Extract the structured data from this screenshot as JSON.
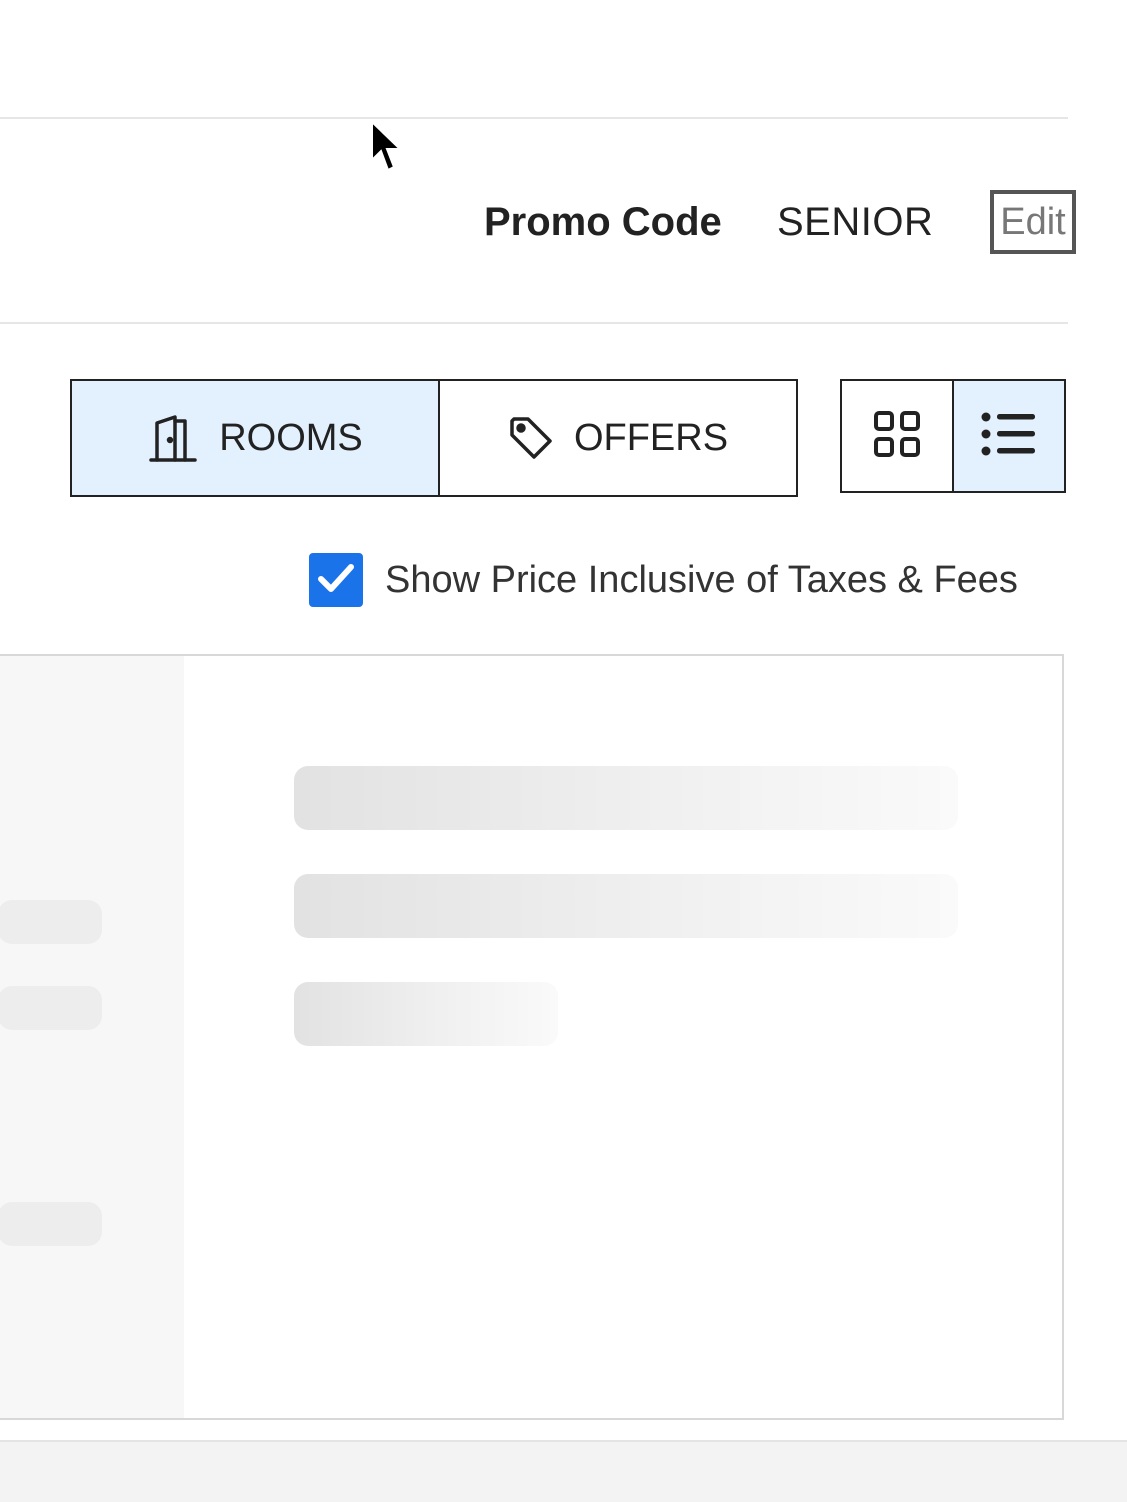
{
  "promo": {
    "label": "Promo Code",
    "value": "SENIOR",
    "edit_label": "Edit"
  },
  "tabs": {
    "rooms": {
      "label": "ROOMS",
      "icon": "door-icon",
      "active": true
    },
    "offers": {
      "label": "OFFERS",
      "icon": "tag-icon",
      "active": false
    }
  },
  "view_toggle": {
    "grid": {
      "icon": "grid-icon",
      "active": false
    },
    "list": {
      "icon": "list-icon",
      "active": true
    }
  },
  "tax_toggle": {
    "label": "Show Price Inclusive of Taxes & Fees",
    "checked": true
  },
  "colors": {
    "accent": "#1a73e8",
    "active_bg": "#e3f1fe",
    "border": "#222222"
  }
}
